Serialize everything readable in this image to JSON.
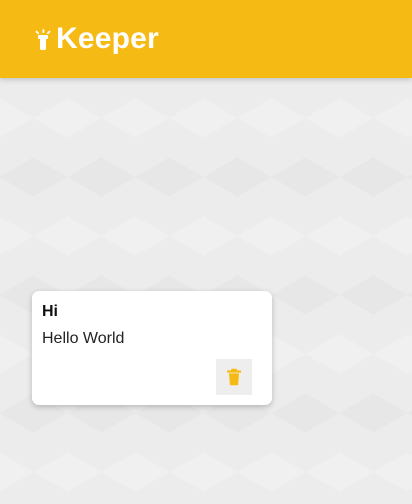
{
  "app": {
    "title": "Keeper"
  },
  "note": {
    "title": "Hi",
    "content": "Hello World"
  },
  "colors": {
    "accent": "#f5ba13",
    "icon": "#f5ba13",
    "background": "#ececec",
    "card": "#ffffff",
    "header_text": "#ffffff"
  },
  "icons": {
    "logo": "highlight-icon",
    "delete": "trash-icon"
  }
}
